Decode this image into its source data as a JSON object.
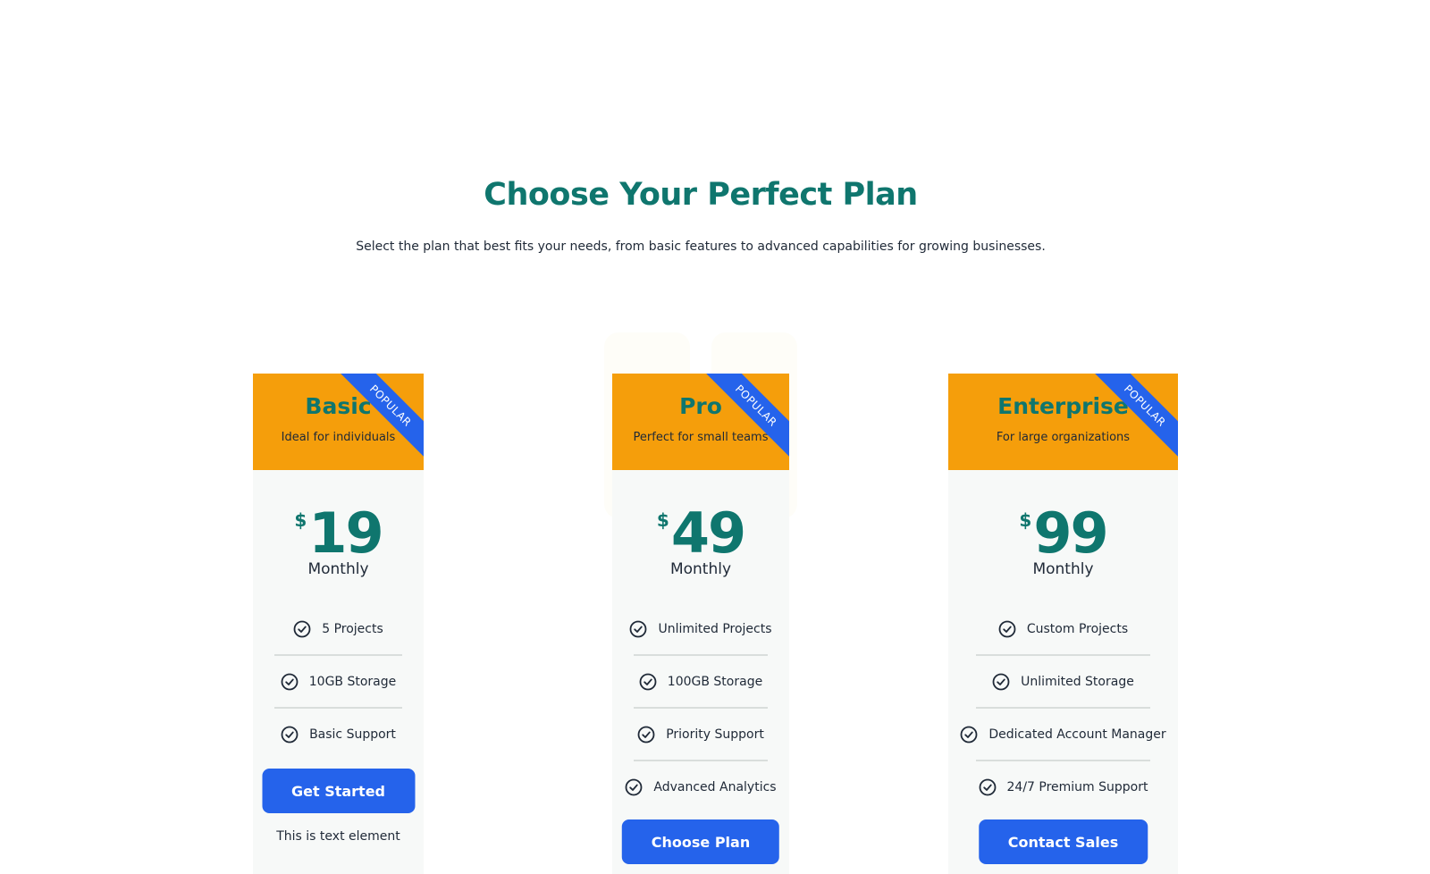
{
  "header": {
    "title": "Choose Your Perfect Plan",
    "subtitle": "Select the plan that best fits your needs, from basic features to advanced capabilities for growing businesses."
  },
  "colors": {
    "accent": "#0f766e",
    "header_bg": "#f59e0b",
    "ribbon": "#2563eb",
    "button": "#2563eb",
    "card_bg": "#f7f9f8"
  },
  "plans": [
    {
      "name": "Basic",
      "description": "Ideal for individuals",
      "ribbon": "POPULAR",
      "currency": "$",
      "price": "19",
      "period": "Monthly",
      "features": [
        "5 Projects",
        "10GB Storage",
        "Basic Support"
      ],
      "cta": "Get Started",
      "note": "This is text element"
    },
    {
      "name": "Pro",
      "description": "Perfect for small teams",
      "ribbon": "POPULAR",
      "currency": "$",
      "price": "49",
      "period": "Monthly",
      "features": [
        "Unlimited Projects",
        "100GB Storage",
        "Priority Support",
        "Advanced Analytics"
      ],
      "cta": "Choose Plan"
    },
    {
      "name": "Enterprise",
      "description": "For large organizations",
      "ribbon": "POPULAR",
      "currency": "$",
      "price": "99",
      "period": "Monthly",
      "features": [
        "Custom Projects",
        "Unlimited Storage",
        "Dedicated Account Manager",
        "24/7 Premium Support"
      ],
      "cta": "Contact Sales"
    }
  ],
  "icons": {
    "feature_check": "check-circle-icon"
  }
}
